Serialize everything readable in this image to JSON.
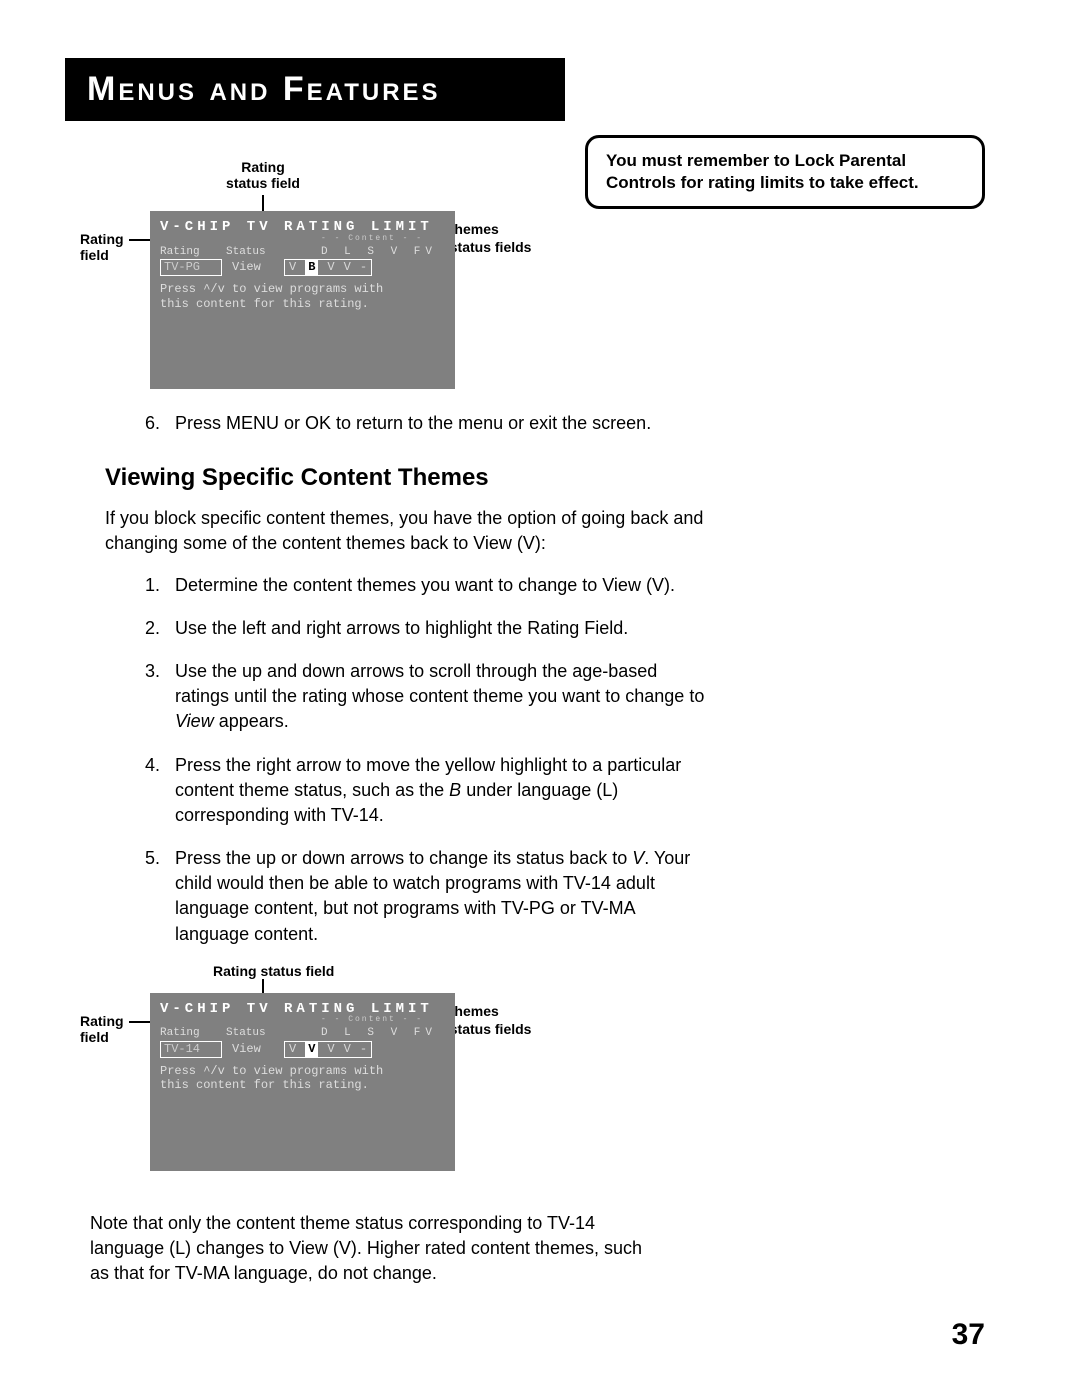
{
  "title": "Menus and Features",
  "notice": "You must remember to Lock Parental Controls for rating limits to take effect.",
  "osd1": {
    "title": "V-CHIP TV RATING LIMIT",
    "content_label": "- - Content - -",
    "headers": {
      "rating": "Rating",
      "status": "Status",
      "themes": "D L S V FV"
    },
    "row": {
      "rating": "TV-PG",
      "status": "View",
      "vals": [
        "V",
        "B",
        "V",
        "V",
        "-"
      ],
      "hi_index": 1
    },
    "msg": "Press ^/v to view programs with\nthis content for this rating."
  },
  "osd2": {
    "title": "V-CHIP TV RATING LIMIT",
    "content_label": "- - Content - -",
    "headers": {
      "rating": "Rating",
      "status": "Status",
      "themes": "D L S V FV"
    },
    "row": {
      "rating": "TV-14",
      "status": "View",
      "vals": [
        "V",
        "V",
        "V",
        "V",
        "-"
      ],
      "hi_index": 1
    },
    "msg": "Press ^/v to view programs with\nthis content for this rating."
  },
  "callouts": {
    "rating_status_field": "Rating\nstatus field",
    "rating_status_field_h": "Rating status field",
    "rating_field": "Rating\nfield",
    "content_themes": "Content themes",
    "content_status_fields": "Content status fields"
  },
  "step6": "Press MENU or OK to return to the menu or exit the screen.",
  "section_heading": "Viewing Specific Content Themes",
  "intro_para": "If you block specific content themes, you have the option of going back and changing some of the content themes back to View (V):",
  "steps": [
    "Determine the content themes you want to change to View (V).",
    "Use the left and right arrows to highlight the Rating Field.",
    "Use the up and down arrows to scroll through the age-based ratings until the rating whose content theme you want to change to View appears.",
    "Press the right arrow to move the yellow highlight to a particular content theme status, such as the B under language (L) corresponding with TV-14.",
    "Press the up or down arrows to change its status back to V. Your child would then be able to watch programs with TV-14 adult language content, but not programs with  TV-PG or TV-MA language content."
  ],
  "note_para": "Note that only the content theme status corresponding to TV-14 language (L) changes to View (V). Higher rated content themes, such as that for TV-MA language, do not change.",
  "page_number": "37"
}
